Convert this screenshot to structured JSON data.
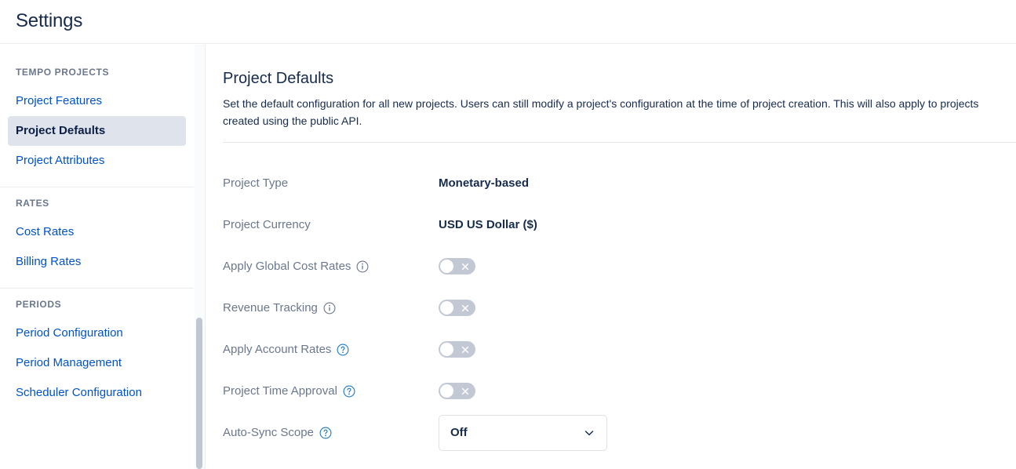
{
  "header": {
    "title": "Settings"
  },
  "sidebar": {
    "sections": [
      {
        "heading": "TEMPO PROJECTS",
        "items": [
          {
            "label": "Project Features",
            "selected": false
          },
          {
            "label": "Project Defaults",
            "selected": true
          },
          {
            "label": "Project Attributes",
            "selected": false
          }
        ]
      },
      {
        "heading": "RATES",
        "items": [
          {
            "label": "Cost Rates",
            "selected": false
          },
          {
            "label": "Billing Rates",
            "selected": false
          }
        ]
      },
      {
        "heading": "PERIODS",
        "items": [
          {
            "label": "Period Configuration",
            "selected": false
          },
          {
            "label": "Period Management",
            "selected": false
          },
          {
            "label": "Scheduler Configuration",
            "selected": false
          }
        ]
      }
    ]
  },
  "main": {
    "title": "Project Defaults",
    "description": "Set the default configuration for all new projects. Users can still modify a project's configuration at the time of project creation. This will also apply to projects created using the public API.",
    "rows": [
      {
        "label": "Project Type",
        "control": "text",
        "value": "Monetary-based",
        "icon": null
      },
      {
        "label": "Project Currency",
        "control": "text",
        "value": "USD US Dollar ($)",
        "icon": null
      },
      {
        "label": "Apply Global Cost Rates",
        "control": "toggle",
        "value": "off",
        "icon": "info-icon"
      },
      {
        "label": "Revenue Tracking",
        "control": "toggle",
        "value": "off",
        "icon": "info-icon"
      },
      {
        "label": "Apply Account Rates",
        "control": "toggle",
        "value": "off",
        "icon": "help-icon"
      },
      {
        "label": "Project Time Approval",
        "control": "toggle",
        "value": "off",
        "icon": "help-icon"
      },
      {
        "label": "Auto-Sync Scope",
        "control": "select",
        "value": "Off",
        "icon": "help-icon"
      }
    ]
  },
  "colors": {
    "link": "#0052CC",
    "text_dark": "#172B4D",
    "text_muted": "#6B778C",
    "selected_bg": "#DFE3EB",
    "toggle_off": "#C2C8D4",
    "border": "#EBECF0"
  }
}
